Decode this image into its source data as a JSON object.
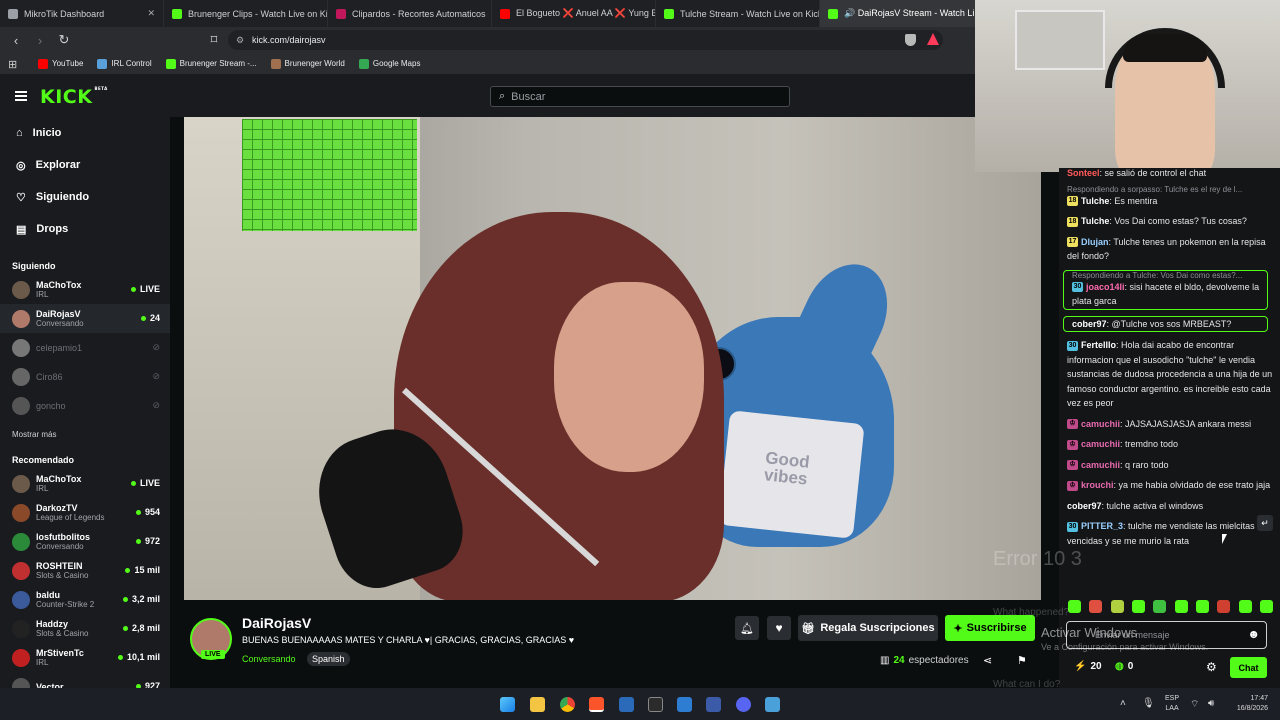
{
  "browser": {
    "tabs": [
      {
        "title": "MikroTik Dashboard",
        "color": "#9aa0a6"
      },
      {
        "title": "Brunenger Clips - Watch Live on Kick",
        "color": "#53fc18"
      },
      {
        "title": "Clipardos - Recortes Automaticos",
        "color": "#c2185b"
      },
      {
        "title": "El Bogueto ❌ Anuel AA ❌ Yung Be",
        "color": "#ff0000"
      },
      {
        "title": "Tulche Stream - Watch Live on Kick",
        "color": "#53fc18"
      },
      {
        "title": "🔊 DaiRojasV Stream - Watch Li",
        "color": "#53fc18"
      }
    ],
    "url": "kick.com/dairojasv",
    "bookmarks": [
      {
        "label": "YouTube",
        "color": "#ff0000"
      },
      {
        "label": "IRL Control",
        "color": "#5aa0d8"
      },
      {
        "label": "Brunenger Stream -...",
        "color": "#53fc18"
      },
      {
        "label": "Brunenger World",
        "color": "#a07050"
      },
      {
        "label": "Google Maps",
        "color": "#34a853"
      }
    ]
  },
  "kick": {
    "logo": "KICK",
    "beta": "BETA",
    "search_placeholder": "Buscar",
    "nav": {
      "home": "Inicio",
      "explore": "Explorar",
      "following": "Siguiendo",
      "drops": "Drops"
    },
    "following_title": "Siguiendo",
    "following": [
      {
        "name": "MaChoTox",
        "category": "IRL",
        "viewers": "LIVE",
        "live": true,
        "avatar_color": "#6b5a4a"
      },
      {
        "name": "DaiRojasV",
        "category": "Conversando",
        "viewers": "24",
        "live": true,
        "avatar_color": "#b07a6a"
      },
      {
        "name": "celepamio1",
        "category": "",
        "viewers": "",
        "live": false,
        "avatar_color": "#777"
      },
      {
        "name": "Ciro86",
        "category": "",
        "viewers": "",
        "live": false,
        "avatar_color": "#666"
      },
      {
        "name": "goncho",
        "category": "",
        "viewers": "",
        "live": false,
        "avatar_color": "#555"
      }
    ],
    "show_more": "Mostrar más",
    "recommended_title": "Recomendado",
    "recommended": [
      {
        "name": "MaChoTox",
        "category": "IRL",
        "viewers": "LIVE",
        "avatar_color": "#6b5a4a"
      },
      {
        "name": "DarkozTV",
        "category": "League of Legends",
        "viewers": "954",
        "avatar_color": "#8a4a2a"
      },
      {
        "name": "losfutbolitos",
        "category": "Conversando",
        "viewers": "972",
        "avatar_color": "#2a8a3a"
      },
      {
        "name": "ROSHTEIN",
        "category": "Slots & Casino",
        "viewers": "15 mil",
        "avatar_color": "#c03030"
      },
      {
        "name": "baldu",
        "category": "Counter-Strike 2",
        "viewers": "3,2 mil",
        "avatar_color": "#3a5a9a"
      },
      {
        "name": "Haddzy",
        "category": "Slots & Casino",
        "viewers": "2,8 mil",
        "avatar_color": "#222"
      },
      {
        "name": "MrStivenTc",
        "category": "IRL",
        "viewers": "10,1 mil",
        "avatar_color": "#c02020"
      },
      {
        "name": "Vector",
        "category": "",
        "viewers": "927",
        "avatar_color": "#555"
      }
    ]
  },
  "stream": {
    "channel": "DaiRojasV",
    "title": "BUENAS BUENAAAAAS MATES Y CHARLA ♥| GRACIAS, GRACIAS, GRACIAS ♥",
    "category": "Conversando",
    "tag": "Spanish",
    "live_label": "LIVE",
    "gift_label": "Regala Suscripciones",
    "subscribe_label": "Suscribirse",
    "viewers": "24",
    "viewers_label": "espectadores",
    "video_text": {
      "shirt": "Good vibes"
    }
  },
  "chat": {
    "top": {
      "user": "Sonteel",
      "text": "se salió de control el chat",
      "color": "#ff5a5a"
    },
    "messages": [
      {
        "reply": "Respondiendo a sorpasso: Tulche es el rey de l...",
        "user": "Tulche",
        "text": "Es mentira",
        "badge": "18",
        "badge_color": "#f0e060",
        "color": "#ffffff"
      },
      {
        "user": "Tulche",
        "text": "Vos Dai como estas? Tus cosas?",
        "badge": "18",
        "badge_color": "#f0e060",
        "color": "#ffffff"
      },
      {
        "user": "Dlujan",
        "text": "Tulche tenes un pokemon en la repisa del fondo?",
        "badge": "17",
        "badge_color": "#f0e060",
        "color": "#9ad0ff"
      },
      {
        "reply": "Respondiendo a Tulche: Vos Dai como estas?...",
        "user": "joaco14li",
        "text": "sisi hacete el bldo, devolveme la plata garca",
        "badge": "30",
        "badge_color": "#53c0e0",
        "color": "#ff6ab0",
        "highlight": true
      },
      {
        "user": "cober97",
        "text": "@Tulche vos sos MRBEAST?",
        "color": "#ffffff",
        "highlight": true
      },
      {
        "user": "Fertelllo",
        "text": "Hola dai acabo de encontrar informacion que el susodicho \"tulche\" le vendia sustancias de dudosa procedencia a una hija de un famoso conductor argentino. es increible esto cada vez es peor",
        "badge": "30",
        "badge_color": "#53c0e0",
        "color": "#ffffff"
      },
      {
        "user": "camuchii",
        "text": "JAJSAJASJASJA ankara messi",
        "badge": "♔",
        "badge_color": "#c04a8a",
        "color": "#e86ab0"
      },
      {
        "user": "camuchii",
        "text": "tremdno todo",
        "badge": "♔",
        "badge_color": "#c04a8a",
        "color": "#e86ab0"
      },
      {
        "user": "camuchii",
        "text": "q raro todo",
        "badge": "♔",
        "badge_color": "#c04a8a",
        "color": "#e86ab0"
      },
      {
        "user": "krouchi",
        "text": "ya me habia olvidado de ese trato jaja",
        "badge": "♔",
        "badge_color": "#c04a8a",
        "color": "#e86ab0"
      },
      {
        "user": "cober97",
        "text": "tulche activa el windows",
        "color": "#ffffff"
      },
      {
        "user": "PITTER_3",
        "text": "tulche me vendiste las mielcitas vencidas y se me murio la rata",
        "badge": "30",
        "badge_color": "#53c0e0",
        "color": "#9ad0ff"
      }
    ],
    "input_placeholder": "Enviar un mensaje",
    "points": "20",
    "kicks": "0",
    "chat_button": "Chat"
  },
  "overlay": {
    "error": "Error 10 3",
    "activate": "Activar Windows",
    "activate_sub": "Ve a Configuración para activar Windows.",
    "what_happen": "What happened?",
    "what_can": "What can I do?"
  },
  "taskbar": {
    "lang": "ESP",
    "lang2": "LAA",
    "time": "17:47",
    "date": "16/8/2026"
  }
}
